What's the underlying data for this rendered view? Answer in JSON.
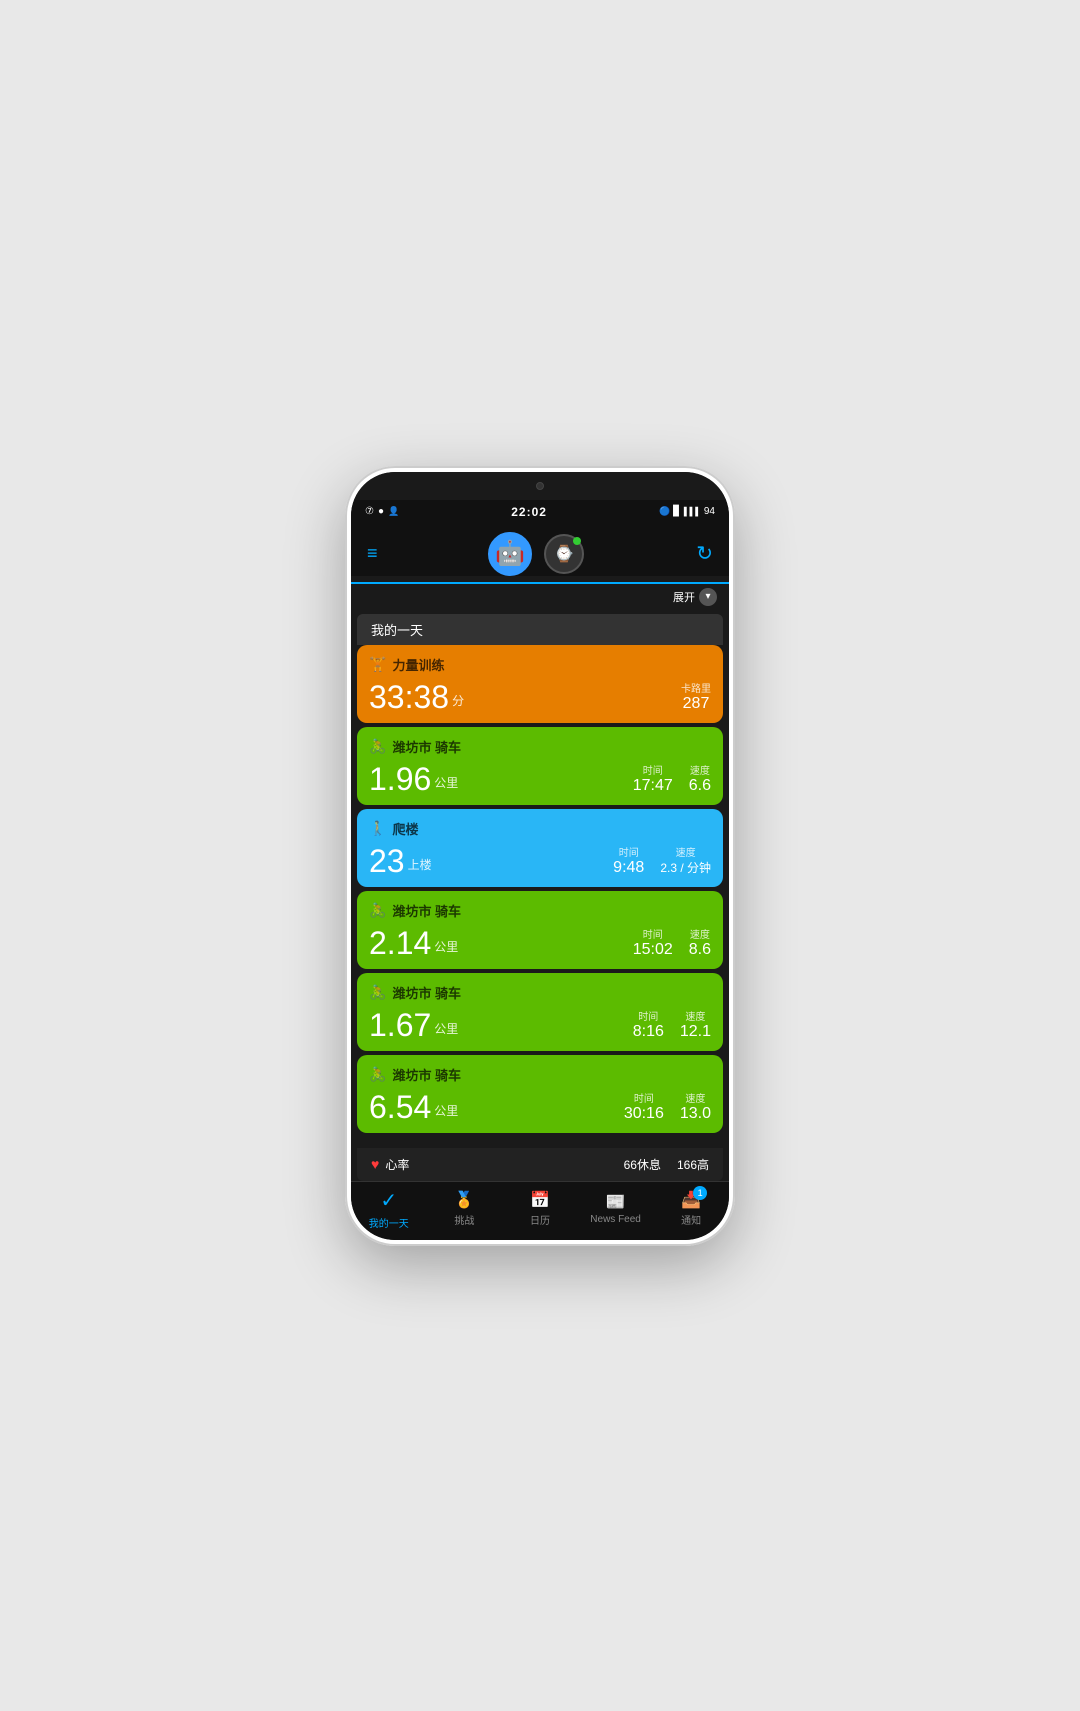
{
  "status_bar": {
    "left_icons": [
      "⑦",
      "●",
      "👤"
    ],
    "time": "22:02",
    "right": [
      "🔵",
      "📶",
      "🔋",
      "94"
    ]
  },
  "header": {
    "menu_label": "≡",
    "avatar_emoji": "🤖",
    "refresh_label": "↻"
  },
  "expand": {
    "text": "展开",
    "icon": "▼"
  },
  "section_title": "我的一天",
  "activities": [
    {
      "id": "strength",
      "color": "orange",
      "icon": "🏋",
      "title": "力量训练",
      "main_value": "33:38",
      "main_unit": "分",
      "stats": [
        {
          "label": "卡路里",
          "value": "287"
        }
      ]
    },
    {
      "id": "cycling1",
      "color": "green",
      "icon": "🚴",
      "title": "潍坊市 骑车",
      "main_value": "1.96",
      "main_unit": "公里",
      "stats": [
        {
          "label": "时间",
          "value": "17:47"
        },
        {
          "label": "速度",
          "value": "6.6"
        }
      ]
    },
    {
      "id": "stairs",
      "color": "blue",
      "icon": "🚶",
      "title": "爬楼",
      "main_value": "23",
      "main_unit": "上楼",
      "stats": [
        {
          "label": "时间",
          "value": "9:48"
        },
        {
          "label": "速度",
          "value": "2.3 / 分钟"
        }
      ]
    },
    {
      "id": "cycling2",
      "color": "green",
      "icon": "🚴",
      "title": "潍坊市 骑车",
      "main_value": "2.14",
      "main_unit": "公里",
      "stats": [
        {
          "label": "时间",
          "value": "15:02"
        },
        {
          "label": "速度",
          "value": "8.6"
        }
      ]
    },
    {
      "id": "cycling3",
      "color": "green",
      "icon": "🚴",
      "title": "潍坊市 骑车",
      "main_value": "1.67",
      "main_unit": "公里",
      "stats": [
        {
          "label": "时间",
          "value": "8:16"
        },
        {
          "label": "速度",
          "value": "12.1"
        }
      ]
    },
    {
      "id": "cycling4",
      "color": "green",
      "icon": "🚴",
      "title": "潍坊市 骑车",
      "main_value": "6.54",
      "main_unit": "公里",
      "stats": [
        {
          "label": "时间",
          "value": "30:16"
        },
        {
          "label": "速度",
          "value": "13.0"
        }
      ]
    }
  ],
  "heart_rate": {
    "label": "心率",
    "resting_label": "66休息",
    "high_label": "166高"
  },
  "bottom_nav": [
    {
      "id": "today",
      "icon": "✓",
      "label": "我的一天",
      "active": true
    },
    {
      "id": "challenge",
      "icon": "🏆",
      "label": "挑战",
      "active": false
    },
    {
      "id": "calendar",
      "icon": "📅",
      "label": "日历",
      "active": false
    },
    {
      "id": "newsfeed",
      "icon": "📰",
      "label": "News Feed",
      "active": false
    },
    {
      "id": "notifications",
      "icon": "📥",
      "label": "通知",
      "active": false,
      "badge": "1"
    }
  ]
}
